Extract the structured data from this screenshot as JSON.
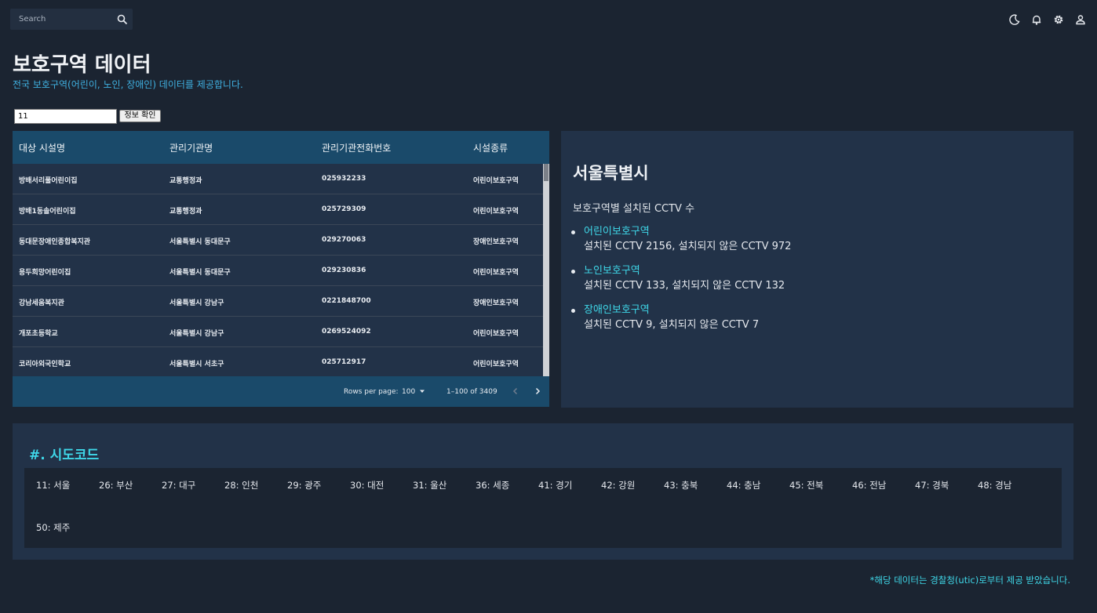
{
  "topbar": {
    "search_placeholder": "Search",
    "icons": [
      "search-icon",
      "moon-icon",
      "bell-icon",
      "gear-icon",
      "user-icon"
    ]
  },
  "header": {
    "title": "보호구역 데이터",
    "subtitle": "전국 보호구역(어린이, 노인, 장애인) 데이터를 제공합니다."
  },
  "query": {
    "code_value": "11",
    "check_button": "정보 확인"
  },
  "table": {
    "columns": [
      "대상 시설명",
      "관리기관명",
      "관리기관전화번호",
      "시설종류"
    ],
    "rows": [
      [
        "방배서리풀어린이집",
        "교통행정과",
        "025932233",
        "어린이보호구역"
      ],
      [
        "방배1동솔어린이집",
        "교통행정과",
        "025729309",
        "어린이보호구역"
      ],
      [
        "동대문장애인종합복지관",
        "서울특별시 동대문구",
        "029270063",
        "장애인보호구역"
      ],
      [
        "용두희망어린이집",
        "서울특별시 동대문구",
        "029230836",
        "어린이보호구역"
      ],
      [
        "강남세움복지관",
        "서울특별시 강남구",
        "0221848700",
        "장애인보호구역"
      ],
      [
        "개포초등학교",
        "서울특별시 강남구",
        "0269524092",
        "어린이보호구역"
      ],
      [
        "코리아외국인학교",
        "서울특별시 서초구",
        "025712917",
        "어린이보호구역"
      ]
    ],
    "footer": {
      "rows_per_page_label": "Rows per page:",
      "rows_per_page_value": "100",
      "page_range": "1–100 of 3409"
    }
  },
  "region": {
    "name": "서울특별시",
    "description": "보호구역별 설치된 CCTV 수",
    "zones": [
      {
        "name": "어린이보호구역",
        "stat": "설치된 CCTV 2156, 설치되지 않은 CCTV 972"
      },
      {
        "name": "노인보호구역",
        "stat": "설치된 CCTV 133, 설치되지 않은 CCTV 132"
      },
      {
        "name": "장애인보호구역",
        "stat": "설치된 CCTV 9, 설치되지 않은 CCTV 7"
      }
    ]
  },
  "sido_codes": {
    "title": "#. 시도코드",
    "items": [
      "11: 서울",
      "26: 부산",
      "27: 대구",
      "28: 인천",
      "29: 광주",
      "30: 대전",
      "31: 울산",
      "36: 세종",
      "41: 경기",
      "42: 강원",
      "43: 충북",
      "44: 충남",
      "45: 전북",
      "46: 전남",
      "47: 경북",
      "48: 경남",
      "50: 제주"
    ]
  },
  "footer_note": "*해당 데이터는 경찰청(utic)로부터 제공 받았습니다.",
  "colors": {
    "background": "#1b2431",
    "panel": "#223248",
    "table_header": "#1a4a6a",
    "accent_cyan": "#3fd7e8",
    "accent_blue": "#3fb0e0"
  }
}
